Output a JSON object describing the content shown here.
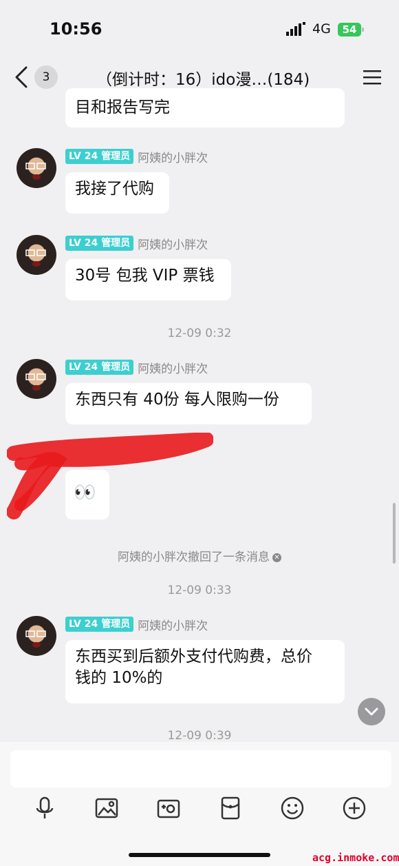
{
  "status": {
    "time": "10:56",
    "network": "4G",
    "battery": "54"
  },
  "nav": {
    "unread": "3",
    "title": "（倒计时：16）ido漫…(184)"
  },
  "member": {
    "level": "LV 24",
    "role": "管理员",
    "name": "阿姨的小胖次"
  },
  "messages": {
    "m0": "目和报告写完",
    "m1": "我接了代购",
    "m2": "30号  包我 VIP 票钱",
    "m3": "东西只有 40份  每人限购一份",
    "m4": "👀",
    "m5_line1": "东西买到后额外支付代购费，总价",
    "m5_line2": "钱的 10%的"
  },
  "timestamps": {
    "t1": "12-09 0:32",
    "t2": "12-09 0:33",
    "t3": "12-09 0:39"
  },
  "recall_notice": "阿姨的小胖次撤回了一条消息",
  "input": {
    "value": ""
  },
  "watermark": "acg.inmoke.com",
  "colors": {
    "level_badge": "#3ccfd0",
    "battery": "#34c759",
    "scribble": "#e8191d"
  }
}
